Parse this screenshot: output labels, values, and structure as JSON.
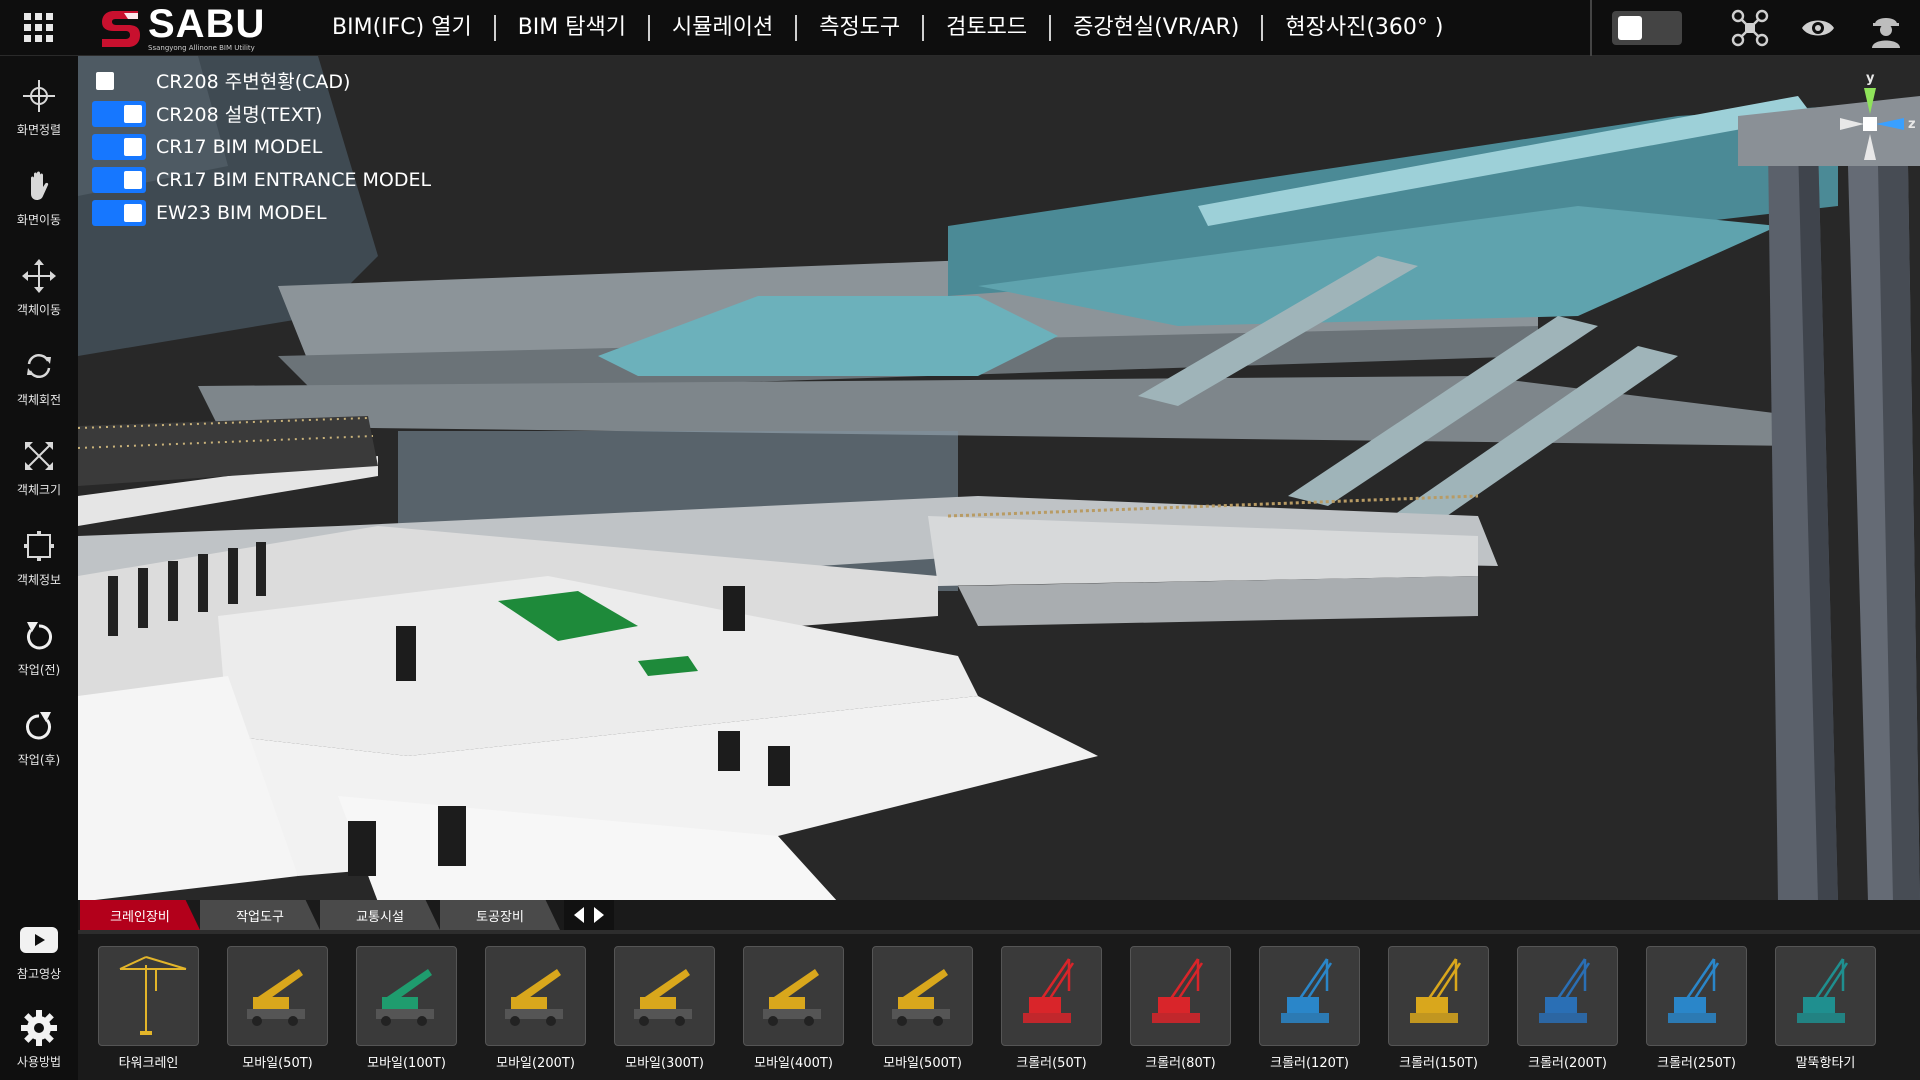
{
  "brand": {
    "title": "SABU",
    "subtitle": "Ssangyong Allinone BIM Utility",
    "accent": "#c8102e"
  },
  "menu": [
    {
      "label": "BIM(IFC) 열기"
    },
    {
      "label": "BIM 탐색기"
    },
    {
      "label": "시뮬레이션"
    },
    {
      "label": "측정도구"
    },
    {
      "label": "검토모드"
    },
    {
      "label": "증강현실(VR/AR)"
    },
    {
      "label": "현장사진(360° )"
    }
  ],
  "top_right": {
    "icons": [
      "toggle-box",
      "drone-icon",
      "eye-icon",
      "worker-icon"
    ]
  },
  "sidebar": {
    "items": [
      {
        "label": "화면정렬",
        "icon": "crosshair-icon"
      },
      {
        "label": "화면이동",
        "icon": "hand-icon"
      },
      {
        "label": "객체이동",
        "icon": "move-arrows-icon"
      },
      {
        "label": "객체회전",
        "icon": "rotate-icon"
      },
      {
        "label": "객체크기",
        "icon": "scale-icon"
      },
      {
        "label": "객체정보",
        "icon": "info-box-icon"
      },
      {
        "label": "작업(전)",
        "icon": "undo-icon"
      },
      {
        "label": "작업(후)",
        "icon": "redo-icon"
      }
    ],
    "bottom": [
      {
        "label": "참고영상",
        "icon": "play-icon"
      },
      {
        "label": "사용방법",
        "icon": "gear-icon"
      }
    ]
  },
  "layers": [
    {
      "name": "CR208 주변현황(CAD)",
      "on": false
    },
    {
      "name": "CR208 설명(TEXT)",
      "on": true
    },
    {
      "name": "CR17 BIM MODEL",
      "on": true
    },
    {
      "name": "CR17 BIM ENTRANCE MODEL",
      "on": true
    },
    {
      "name": "EW23 BIM MODEL",
      "on": true
    }
  ],
  "axis": {
    "y": "y",
    "z": "z"
  },
  "tray": {
    "tabs": [
      "크레인장비",
      "작업도구",
      "교통시설",
      "토공장비"
    ],
    "active_tab": 0,
    "items": [
      {
        "label": "타워크레인",
        "color": "#e3b52a"
      },
      {
        "label": "모바일(50T)",
        "color": "#d9a71c"
      },
      {
        "label": "모바일(100T)",
        "color": "#1f9c6e"
      },
      {
        "label": "모바일(200T)",
        "color": "#d9a71c"
      },
      {
        "label": "모바일(300T)",
        "color": "#d9a71c"
      },
      {
        "label": "모바일(400T)",
        "color": "#d9a71c"
      },
      {
        "label": "모바일(500T)",
        "color": "#d9a71c"
      },
      {
        "label": "크롤러(50T)",
        "color": "#d9252a"
      },
      {
        "label": "크롤러(80T)",
        "color": "#d9252a"
      },
      {
        "label": "크롤러(120T)",
        "color": "#2a86c9"
      },
      {
        "label": "크롤러(150T)",
        "color": "#d9a71c"
      },
      {
        "label": "크롤러(200T)",
        "color": "#2a6fb5"
      },
      {
        "label": "크롤러(250T)",
        "color": "#2a86c9"
      },
      {
        "label": "말뚝항타기",
        "color": "#1f8f8f"
      }
    ]
  }
}
